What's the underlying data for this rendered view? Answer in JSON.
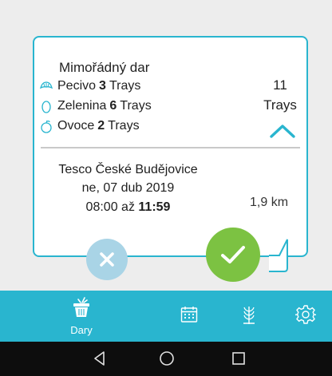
{
  "offer": {
    "title": "Mimořádný dar",
    "items": [
      {
        "name": "Pecivo",
        "count": "3",
        "unit": "Trays",
        "icon": "croissant-icon"
      },
      {
        "name": "Zelenina",
        "count": "6",
        "unit": "Trays",
        "icon": "vegetable-icon"
      },
      {
        "name": "Ovoce",
        "count": "2",
        "unit": "Trays",
        "icon": "apple-icon"
      }
    ],
    "total_count": "11",
    "total_unit": "Trays"
  },
  "pickup": {
    "store": "Tesco České Budějovice",
    "date": "ne, 07 dub 2019",
    "time_from": "08:00",
    "time_sep": "až",
    "time_to": "11:59",
    "distance": "1,9 km"
  },
  "nav": {
    "items": [
      {
        "label": "Dary",
        "icon": "basket-icon",
        "active": true
      },
      {
        "label": "",
        "icon": "calendar-icon"
      },
      {
        "label": "",
        "icon": "wheat-icon"
      },
      {
        "label": "",
        "icon": "gear-icon"
      }
    ]
  },
  "colors": {
    "accent": "#29b5cf",
    "accept": "#7cc242",
    "decline": "#a9d4e6",
    "system_bar": "#0d0d0d"
  }
}
